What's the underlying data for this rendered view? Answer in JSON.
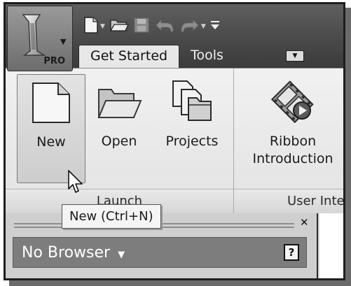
{
  "app": {
    "badge": "PRO",
    "menu_icon": "autodesk-inventor-logo-icon"
  },
  "quick_access": {
    "items": [
      {
        "name": "new-file-icon"
      },
      {
        "name": "open-folder-icon"
      },
      {
        "name": "save-icon"
      },
      {
        "name": "undo-icon"
      },
      {
        "name": "redo-icon"
      },
      {
        "name": "customize-dropdown-icon"
      }
    ]
  },
  "tabs": [
    {
      "label": "Get Started",
      "active": true
    },
    {
      "label": "Tools",
      "active": false
    }
  ],
  "ribbon": {
    "launch_panel": {
      "footer": "Launch",
      "tools": [
        {
          "label": "New",
          "icon": "new-document-icon",
          "highlighted": true
        },
        {
          "label": "Open",
          "icon": "open-folder-icon"
        },
        {
          "label": "Projects",
          "icon": "projects-icon"
        }
      ]
    },
    "ui_panel": {
      "footer": "User Interface",
      "tools": [
        {
          "label_line1": "Ribbon",
          "label_line2": "Introduction",
          "icon": "film-play-icon"
        }
      ]
    }
  },
  "tooltip": {
    "text": "New (Ctrl+N)"
  },
  "browser": {
    "title": "No Browser",
    "help_label": "?"
  },
  "colors": {
    "titlebar": "#4a4a4a",
    "ribbon": "#e8e8e8",
    "browser_bar": "#7d7d7d"
  }
}
